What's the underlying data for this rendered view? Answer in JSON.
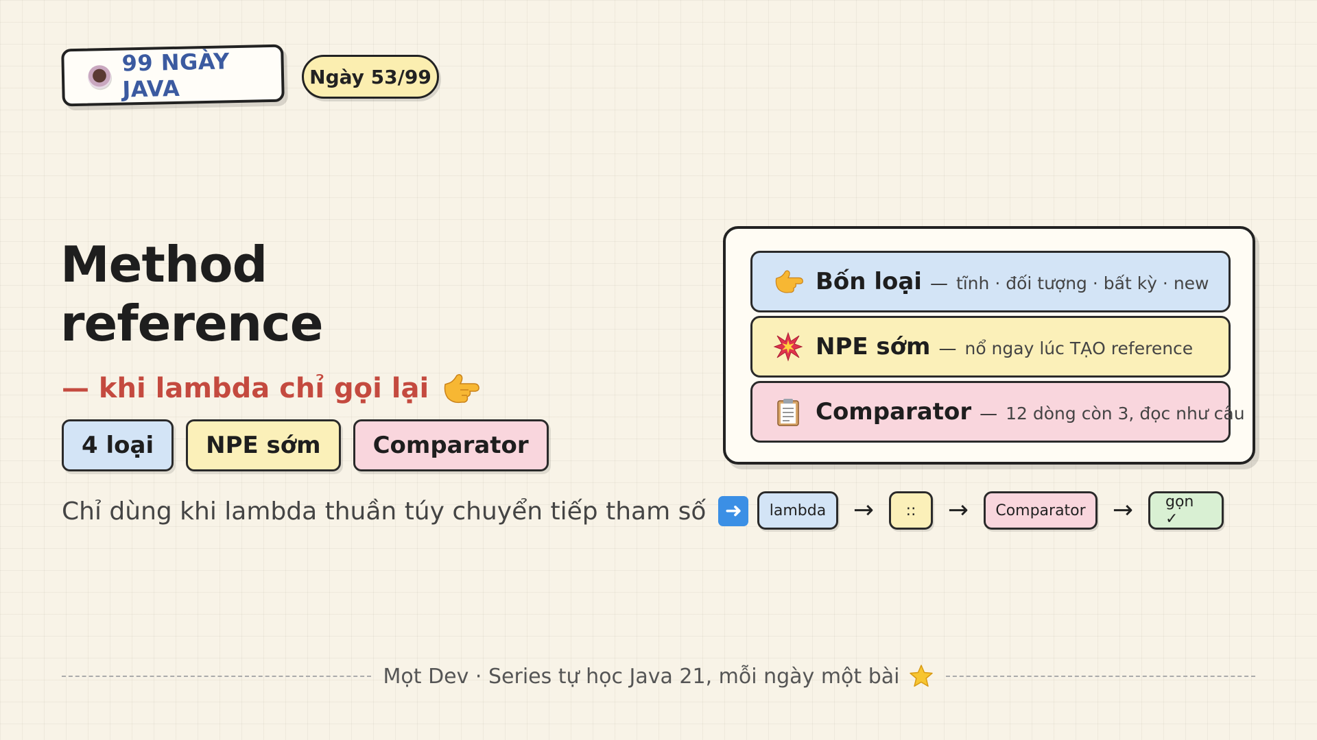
{
  "header": {
    "series_title": "99 NGÀY JAVA",
    "day_badge": "Ngày 53/99",
    "icons": {
      "series": "coffee-cup-icon"
    }
  },
  "title": {
    "line1": "Method",
    "line2": "reference",
    "subtitle": "— khi lambda chỉ gọi lại",
    "subtitle_icon": "pointing-hand-icon"
  },
  "tags": [
    {
      "label": "4 loại",
      "color": "#d3e4f6"
    },
    {
      "label": "NPE sớm",
      "color": "#fbf0b9"
    },
    {
      "label": "Comparator",
      "color": "#f9d6dd"
    }
  ],
  "note": {
    "text": "Chỉ dùng khi lambda thuần túy chuyển tiếp tham số",
    "icon": "right-arrow-icon"
  },
  "card": {
    "rows": [
      {
        "icon": "pointing-hand-icon",
        "title": "Bốn loại",
        "sep": "—",
        "desc": "tĩnh · đối tượng · bất kỳ · new",
        "color": "#d3e4f6"
      },
      {
        "icon": "explosion-icon",
        "title": "NPE sớm",
        "sep": "—",
        "desc": "nổ ngay lúc TẠO reference",
        "color": "#fbf0b9"
      },
      {
        "icon": "clipboard-icon",
        "title": "Comparator",
        "sep": "—",
        "desc": "12 dòng còn 3, đọc như câu",
        "color": "#f9d6dd"
      }
    ]
  },
  "flow": {
    "steps": [
      "lambda",
      "::",
      "Comparator",
      "gọn ✓"
    ],
    "arrow": "→"
  },
  "footer": {
    "text": "Mọt Dev · Series tự học Java 21, mỗi ngày một bài",
    "icon": "star-icon"
  },
  "colors": {
    "background": "#f8f3e7",
    "accent_blue": "#3b5aa0",
    "accent_red": "#c44a3f",
    "badge_yellow": "#fbeeb0"
  }
}
